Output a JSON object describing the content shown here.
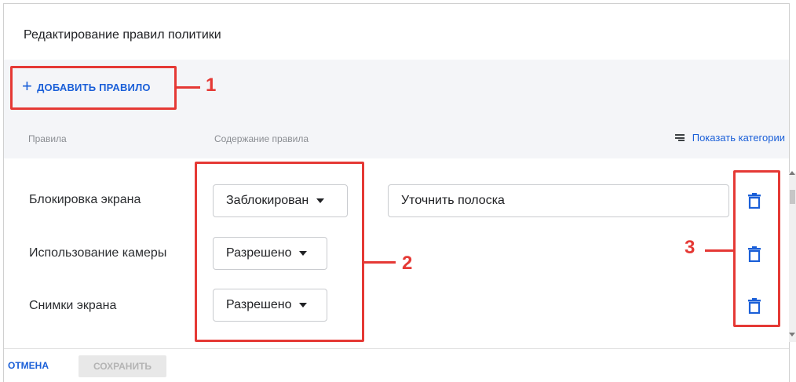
{
  "dialog": {
    "title": "Редактирование правил политики"
  },
  "toolbar": {
    "add_rule_icon": "+",
    "add_rule_label": "ДОБАВИТЬ ПРАВИЛО"
  },
  "columns": {
    "rules": "Правила",
    "content": "Содержание правила",
    "show_categories": "Показать категории"
  },
  "rows": [
    {
      "label": "Блокировка экрана",
      "select_value": "Заблокирован",
      "text_value": "Уточнить полоска"
    },
    {
      "label": "Использование камеры",
      "select_value": "Разрешено"
    },
    {
      "label": "Снимки экрана",
      "select_value": "Разрешено"
    }
  ],
  "annotations": {
    "marker_1": "1",
    "marker_2": "2",
    "marker_3": "3",
    "color": "#e53935"
  },
  "footer": {
    "cancel_label": "ОТМЕНА",
    "save_label": "СОХРАНИТЬ"
  },
  "icons": {
    "add": "plus-icon",
    "categories": "menu-lines-icon",
    "dropdown": "caret-down-icon",
    "delete": "trash-icon"
  },
  "colors": {
    "accent": "#1a5fd8",
    "annotation": "#e53935",
    "band": "#f4f5f8"
  }
}
